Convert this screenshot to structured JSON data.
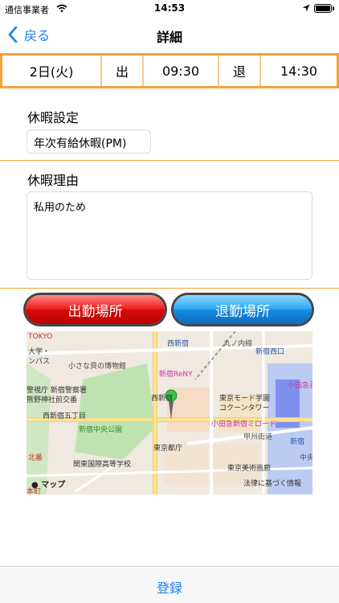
{
  "status": {
    "carrier": "通信事業者",
    "time": "14:53"
  },
  "nav": {
    "back_label": "戻る",
    "title": "詳細"
  },
  "times": {
    "date": "2日(火)",
    "in_label": "出",
    "in_time": "09:30",
    "out_label": "退",
    "out_time": "14:30"
  },
  "leave_setting": {
    "label": "休暇設定",
    "value": "年次有給休暇(PM)"
  },
  "leave_reason": {
    "label": "休暇理由",
    "value": "私用のため"
  },
  "buttons": {
    "clock_in_location": "出勤場所",
    "clock_out_location": "退勤場所"
  },
  "map": {
    "labels": {
      "tokyo": "TOKYO",
      "univ": "大学・",
      "campus": "ンパス",
      "museum": "小さな貝の博物館",
      "nishishinjuku": "西新宿",
      "marunouchi": "丸ノ内線",
      "shinjuku_nishiguchi": "新宿西口",
      "shinjuku_reny": "新宿ReNY",
      "odakyu": "小田急百",
      "keishicho": "警視庁 新宿警察署",
      "kumano": "熊野神社前交番",
      "nishishinjuku_kana": "西新宿",
      "mode_gakuen": "東京モード学園",
      "cocoon": "コクーンタワー",
      "nishishinjuku5": "西新宿五丁目",
      "chuo_park": "新宿中央公園",
      "odakyu_mirod": "小田急新宿ミロード",
      "koshu": "甲州街道",
      "shinjuku": "新宿",
      "tocho": "東京都庁",
      "kokusai": "関東国際高等学校",
      "bijutsu": "東京美術画廊",
      "chuo": "中央",
      "kitaban": "北番",
      "hatsudai": "本町",
      "maps_brand": "マップ",
      "horitsu": "法律に基づく情報"
    }
  },
  "toolbar": {
    "register_label": "登録"
  },
  "colors": {
    "accent": "#1a7cf2",
    "border_orange": "#f7a23b",
    "red_button": "#e01010",
    "blue_button": "#1e94e8"
  }
}
